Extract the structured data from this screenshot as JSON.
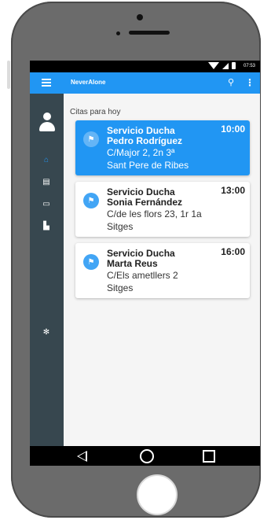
{
  "app": {
    "title": "NeverAlone"
  },
  "status_bar": {
    "time": "07:53"
  },
  "icons": {
    "menu": "hamburger-icon",
    "search": "search-icon",
    "more": "more-vertical-icon",
    "avatar": "user-avatar-icon",
    "home": "home-icon",
    "messages": "message-icon",
    "calendar": "calendar-icon",
    "stats": "stats-icon",
    "settings": "gear-icon",
    "flag": "flag-icon"
  },
  "colors": {
    "appbar": "#2196f3",
    "sidebar": "#37474f",
    "active_card": "#2196f3"
  },
  "section_title": "Citas para hoy",
  "appointments": [
    {
      "title": "Servicio Ducha",
      "name": "Pedro Rodríguez",
      "address": "C/Major 2, 2n 3ª",
      "city": "Sant Pere de Ribes",
      "time": "10:00",
      "active": true
    },
    {
      "title": "Servicio Ducha",
      "name": "Sonia Fernández",
      "address": "C/de les flors 23, 1r 1a",
      "city": "Sitges",
      "time": "13:00",
      "active": false
    },
    {
      "title": "Servicio Ducha",
      "name": "Marta Reus",
      "address": "C/Els ametllers 2",
      "city": "Sitges",
      "time": "16:00",
      "active": false
    }
  ]
}
